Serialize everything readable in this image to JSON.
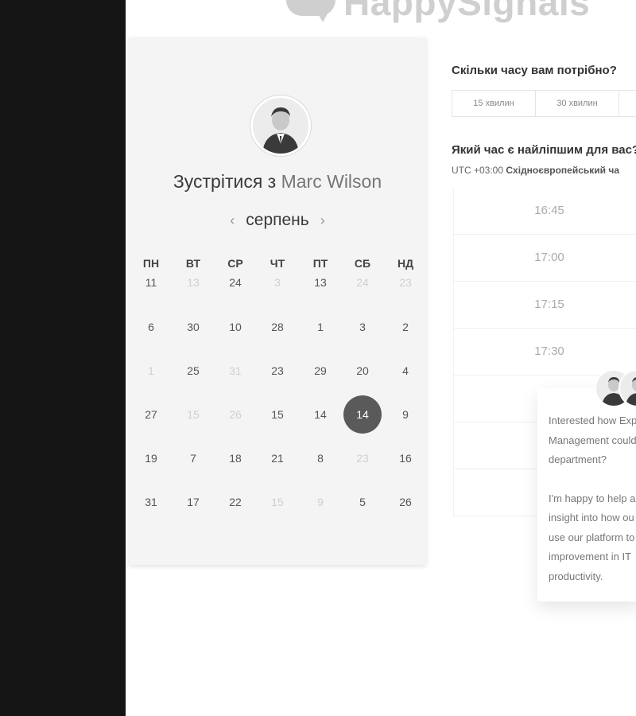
{
  "brand": {
    "logo_text": "HappySignals"
  },
  "calendar": {
    "title_prefix": "Зустрітися з",
    "host_name": "Marc Wilson",
    "month": "серпень",
    "prev_icon": "‹",
    "next_icon": "›",
    "weekdays": [
      "ПН",
      "ВТ",
      "СР",
      "ЧТ",
      "ПТ",
      "СБ",
      "НД"
    ],
    "weeks": [
      [
        {
          "d": "11"
        },
        {
          "d": "13",
          "m": true
        },
        {
          "d": "24"
        },
        {
          "d": "3",
          "m": true
        },
        {
          "d": "13"
        },
        {
          "d": "24",
          "m": true
        },
        {
          "d": "23",
          "m": true
        }
      ],
      [
        {
          "d": "6"
        },
        {
          "d": "30"
        },
        {
          "d": "10"
        },
        {
          "d": "28"
        },
        {
          "d": "1"
        },
        {
          "d": "3"
        },
        {
          "d": "2"
        }
      ],
      [
        {
          "d": "1",
          "m": true
        },
        {
          "d": "25"
        },
        {
          "d": "31",
          "m": true
        },
        {
          "d": "23"
        },
        {
          "d": "29"
        },
        {
          "d": "20"
        },
        {
          "d": "4"
        }
      ],
      [
        {
          "d": "27"
        },
        {
          "d": "15",
          "m": true
        },
        {
          "d": "26",
          "m": true
        },
        {
          "d": "15"
        },
        {
          "d": "14"
        },
        {
          "d": "14",
          "sel": true
        },
        {
          "d": "9"
        }
      ],
      [
        {
          "d": "19"
        },
        {
          "d": "7"
        },
        {
          "d": "18"
        },
        {
          "d": "21"
        },
        {
          "d": "8"
        },
        {
          "d": "23",
          "m": true
        },
        {
          "d": "16"
        }
      ],
      [
        {
          "d": "31"
        },
        {
          "d": "17"
        },
        {
          "d": "22"
        },
        {
          "d": "15",
          "m": true
        },
        {
          "d": "9",
          "m": true
        },
        {
          "d": "5"
        },
        {
          "d": "26"
        }
      ]
    ]
  },
  "duration": {
    "question": "Скільки часу вам потрібно?",
    "options": [
      "15 хвилин",
      "30 хвилин"
    ]
  },
  "time": {
    "question": "Який час є найліпшим для вас?",
    "tz_offset": "UTC +03:00",
    "tz_name": "Східноєвропейський ча",
    "slots": [
      "16:45",
      "17:00",
      "17:15",
      "17:30",
      "",
      "",
      ""
    ]
  },
  "chat": {
    "lines": [
      "Interested how Exp",
      "Management could",
      "department?",
      "",
      "I'm happy to help a",
      "insight into how ou",
      "use our platform to",
      "improvement in IT",
      "productivity."
    ]
  },
  "colors": {
    "sidebar": "#151515",
    "selected_day": "#5a5a5a",
    "card": "#f4f4f4"
  }
}
